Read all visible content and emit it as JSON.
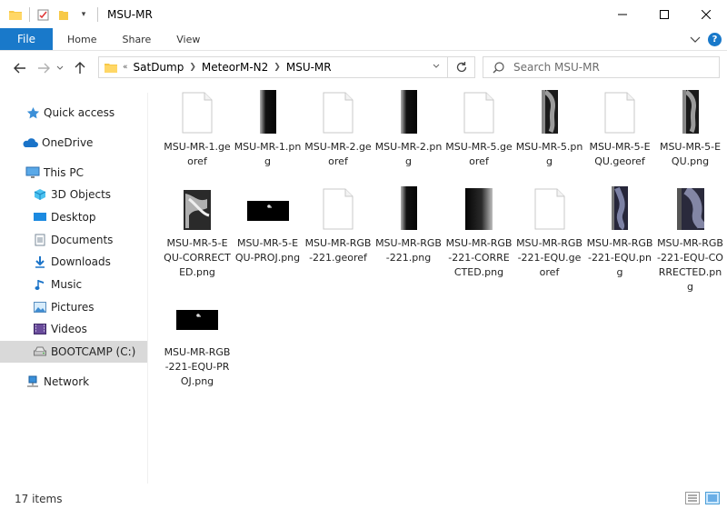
{
  "window": {
    "title": "MSU-MR",
    "controls": {
      "minimize": "—",
      "maximize": "☐",
      "close": "✕"
    }
  },
  "ribbon": {
    "file": "File",
    "tabs": [
      "Home",
      "Share",
      "View"
    ]
  },
  "address": {
    "crumbs": [
      "SatDump",
      "MeteorM-N2",
      "MSU-MR"
    ],
    "search_placeholder": "Search MSU-MR"
  },
  "sidebar": {
    "items": [
      {
        "label": "Quick access",
        "icon": "star-icon"
      },
      {
        "label": "OneDrive",
        "icon": "cloud-icon"
      },
      {
        "label": "This PC",
        "icon": "computer-icon"
      },
      {
        "label": "3D Objects",
        "icon": "cube-icon"
      },
      {
        "label": "Desktop",
        "icon": "desktop-icon"
      },
      {
        "label": "Documents",
        "icon": "document-icon"
      },
      {
        "label": "Downloads",
        "icon": "download-icon"
      },
      {
        "label": "Music",
        "icon": "music-icon"
      },
      {
        "label": "Pictures",
        "icon": "pictures-icon"
      },
      {
        "label": "Videos",
        "icon": "videos-icon"
      },
      {
        "label": "BOOTCAMP (C:)",
        "icon": "drive-icon"
      },
      {
        "label": "Network",
        "icon": "network-icon"
      }
    ]
  },
  "files": [
    {
      "name": "MSU-MR-1.georef",
      "type": "doc"
    },
    {
      "name": "MSU-MR-1.png",
      "type": "tall-dark"
    },
    {
      "name": "MSU-MR-2.georef",
      "type": "doc"
    },
    {
      "name": "MSU-MR-2.png",
      "type": "tall-dark"
    },
    {
      "name": "MSU-MR-5.georef",
      "type": "doc"
    },
    {
      "name": "MSU-MR-5.png",
      "type": "tall-grey"
    },
    {
      "name": "MSU-MR-5-EQU.georef",
      "type": "doc"
    },
    {
      "name": "MSU-MR-5-EQU.png",
      "type": "tall-grey"
    },
    {
      "name": "MSU-MR-5-EQU-CORRECTED.png",
      "type": "square-grey"
    },
    {
      "name": "MSU-MR-5-EQU-PROJ.png",
      "type": "wide-black"
    },
    {
      "name": "MSU-MR-RGB-221.georef",
      "type": "doc"
    },
    {
      "name": "MSU-MR-RGB-221.png",
      "type": "tall-dark"
    },
    {
      "name": "MSU-MR-RGB-221-CORRECTED.png",
      "type": "square-dark"
    },
    {
      "name": "MSU-MR-RGB-221-EQU.georef",
      "type": "doc"
    },
    {
      "name": "MSU-MR-RGB-221-EQU.png",
      "type": "tall-blue"
    },
    {
      "name": "MSU-MR-RGB-221-EQU-CORRECTED.png",
      "type": "square-blue"
    },
    {
      "name": "MSU-MR-RGB-221-EQU-PROJ.png",
      "type": "wide-black"
    }
  ],
  "status": {
    "count": "17 items"
  }
}
